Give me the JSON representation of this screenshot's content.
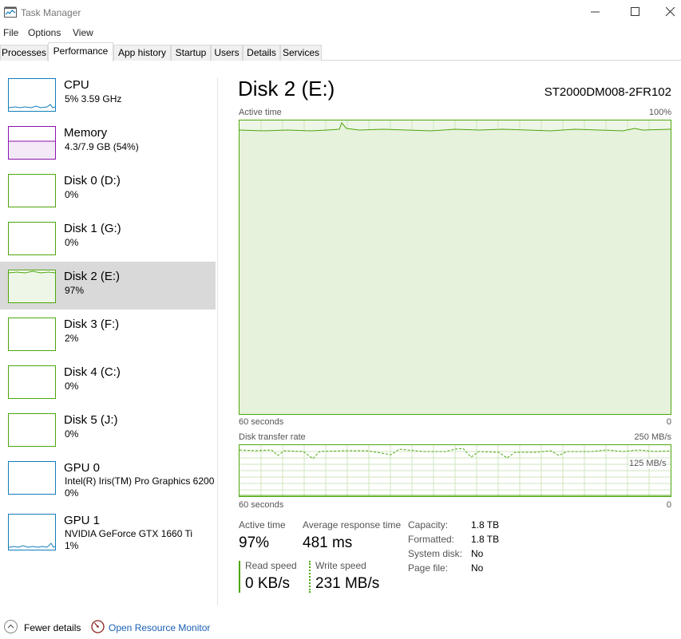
{
  "window": {
    "title": "Task Manager"
  },
  "menu": [
    "File",
    "Options",
    "View"
  ],
  "tabs": [
    "Processes",
    "Performance",
    "App history",
    "Startup",
    "Users",
    "Details",
    "Services"
  ],
  "active_tab": "Performance",
  "sidebar": [
    {
      "name": "CPU",
      "sub": "5% 3.59 GHz",
      "color": "#117dbb"
    },
    {
      "name": "Memory",
      "sub": "4.3/7.9 GB (54%)",
      "color": "#8b12ae"
    },
    {
      "name": "Disk 0 (D:)",
      "sub": "0%",
      "color": "#4da60c"
    },
    {
      "name": "Disk 1 (G:)",
      "sub": "0%",
      "color": "#4da60c"
    },
    {
      "name": "Disk 2 (E:)",
      "sub": "97%",
      "color": "#4da60c",
      "selected": true
    },
    {
      "name": "Disk 3 (F:)",
      "sub": "2%",
      "color": "#4da60c"
    },
    {
      "name": "Disk 4 (C:)",
      "sub": "0%",
      "color": "#4da60c"
    },
    {
      "name": "Disk 5 (J:)",
      "sub": "0%",
      "color": "#4da60c"
    },
    {
      "name": "GPU 0",
      "sub": "Intel(R) Iris(TM) Pro Graphics 6200",
      "sub2": "0%",
      "color": "#117dbb"
    },
    {
      "name": "GPU 1",
      "sub": "NVIDIA GeForce GTX 1660 Ti",
      "sub2": "1%",
      "color": "#117dbb"
    }
  ],
  "main": {
    "title": "Disk 2 (E:)",
    "model": "ST2000DM008-2FR102",
    "graph1": {
      "label": "Active time",
      "max": "100%",
      "time": "60 seconds",
      "min": "0"
    },
    "graph2": {
      "label": "Disk transfer rate",
      "max": "250 MB/s",
      "mid": "125 MB/s",
      "time": "60 seconds",
      "min": "0"
    },
    "stats": {
      "active_time_label": "Active time",
      "active_time_value": "97%",
      "avg_response_label": "Average response time",
      "avg_response_value": "481 ms",
      "read_label": "Read speed",
      "read_value": "0 KB/s",
      "write_label": "Write speed",
      "write_value": "231 MB/s"
    },
    "details": [
      {
        "key": "Capacity:",
        "value": "1.8 TB"
      },
      {
        "key": "Formatted:",
        "value": "1.8 TB"
      },
      {
        "key": "System disk:",
        "value": "No"
      },
      {
        "key": "Page file:",
        "value": "No"
      }
    ]
  },
  "footer": {
    "fewer_details": "Fewer details",
    "resource_monitor": "Open Resource Monitor"
  },
  "colors": {
    "disk_green": "#4da60c",
    "cpu_blue": "#117dbb",
    "memory_purple": "#8b12ae",
    "selected_bg": "#d9d9d9",
    "link_blue": "#1a5fb4"
  }
}
